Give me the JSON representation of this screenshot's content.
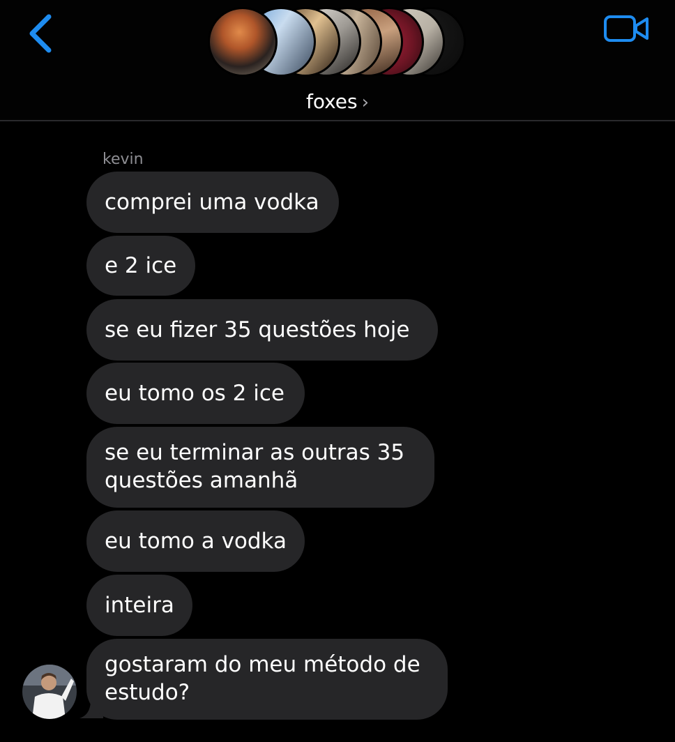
{
  "header": {
    "group_name": "foxes",
    "chevron": "›",
    "back_icon": "chevron-left-icon",
    "video_icon": "video-camera-icon",
    "accent_color": "#1e8cf0"
  },
  "conversation": {
    "sender_name": "kevin",
    "messages": [
      {
        "text": "comprei uma vodka"
      },
      {
        "text": "e 2 ice"
      },
      {
        "text": "se eu fizer 35 questões hoje"
      },
      {
        "text": "eu tomo os 2 ice"
      },
      {
        "line1": "se eu terminar as outras 35",
        "line2": "questões amanhã"
      },
      {
        "text": "eu tomo a vodka"
      },
      {
        "text": "inteira"
      },
      {
        "line1": "gostaram do meu método de",
        "line2": "estudo?"
      }
    ]
  },
  "colors": {
    "background": "#000000",
    "bubble": "#262628",
    "secondary_text": "#8e8e93"
  }
}
